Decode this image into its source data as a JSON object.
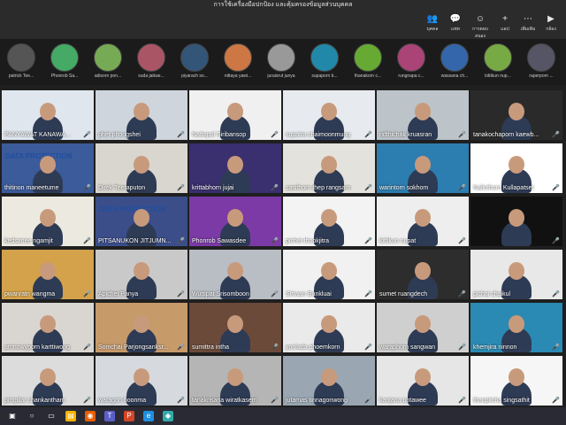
{
  "window": {
    "title": "การใช้เครื่องมือปกป้อง และคุ้มครองข้อมูลส่วนบุคคล"
  },
  "toolbar": {
    "buttons": [
      {
        "label": "บุคคล",
        "icon": "people-icon"
      },
      {
        "label": "แชท",
        "icon": "chat-icon"
      },
      {
        "label": "การตอบสนอง",
        "icon": "reactions-icon"
      },
      {
        "label": "แอป",
        "icon": "apps-icon"
      },
      {
        "label": "เพิ่มเติม",
        "icon": "more-icon"
      },
      {
        "label": "กล้อง",
        "icon": "camera-icon"
      }
    ]
  },
  "strip": {
    "people": [
      "patrick Tee...",
      "Phonrob Sa...",
      "adisorn pon...",
      "suda jaikae...",
      "piyarach so...",
      "nittaya yawi...",
      "juraisrut junya",
      "supaporn b...",
      "thanakorn c...",
      "rungnapa c...",
      "wassana ch...",
      "kittikun nup...",
      "raperporn ..."
    ]
  },
  "grid": {
    "tiles": [
      "PANYAWAT KANAWA...",
      "phet phongshei",
      "Nattapol Siribansop",
      "supatra chaimoonmung",
      "ridthichak kruasran",
      "tanakochaporn kaewb...",
      "thitinon maneetume",
      "Direk Teeraputon",
      "krittabhorn jujai",
      "sasithorn thep rangsarn",
      "warintorn sokhom",
      "Nalinthorn Kullapatset",
      "kedsanee ngamjit",
      "PITSANUKON JITJUMN...",
      "Phonrob Sawasdee",
      "pichet thookjitra",
      "kittikun nupat",
      "",
      "pwanratn wangma",
      "Apichet Panya",
      "Wuttipat Srisomboon",
      "Siriwan Bankluai",
      "sumet ruangdech",
      "pichai chaikul",
      "amnowyporn karttiwong",
      "Somchai Parjongsanksr...",
      "sumittra intha",
      "yonlada phoemkorn",
      "waraphorn sangwan",
      "khemjira ninnon",
      "pimpilar chankantham",
      "waragon boonma",
      "tanakrisana wiratkasem",
      "jutamas tinnagonwong",
      "kanjana potawee",
      "thanpitcha singsathit"
    ],
    "banner_text": "DATA PROTECTION"
  },
  "taskbar": {
    "icons": [
      "windows-icon",
      "search-icon",
      "taskview-icon",
      "explorer-icon",
      "firefox-icon",
      "teams-icon",
      "powerpoint-icon",
      "edge-icon",
      "app-icon"
    ]
  },
  "colors": {
    "leave_red": "#c4314b",
    "teams_purple": "#5b5fc7"
  }
}
